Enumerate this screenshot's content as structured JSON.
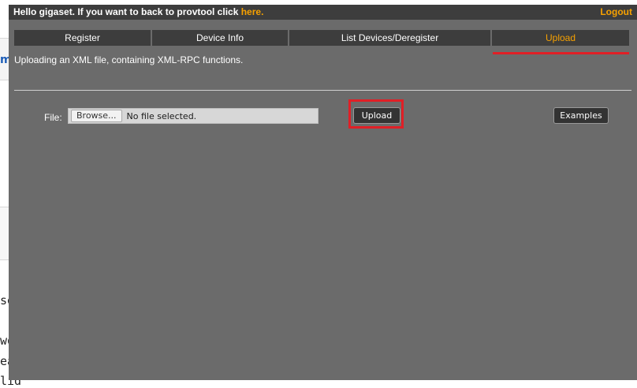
{
  "background": {
    "fragment_blue": "ml",
    "fragments": [
      "se",
      "word",
      "eady_in_use",
      "lid"
    ]
  },
  "topbar": {
    "greeting": "Hello gigaset. If you want to back to provtool click ",
    "here_link": "here.",
    "logout": "Logout"
  },
  "tabs": [
    {
      "label": "Register"
    },
    {
      "label": "Device Info"
    },
    {
      "label": "List Devices/Deregister"
    },
    {
      "label": "Upload",
      "active": true
    }
  ],
  "upload": {
    "description": "Uploading an XML file, containing XML-RPC functions.",
    "file_label": "File:",
    "browse_label": "Browse...",
    "file_status": "No file selected.",
    "upload_button": "Upload",
    "examples_button": "Examples"
  },
  "colors": {
    "accent": "#f7a100",
    "highlight": "#e01f26",
    "panel": "#6b6b6b",
    "bar": "#3d3d3d"
  }
}
